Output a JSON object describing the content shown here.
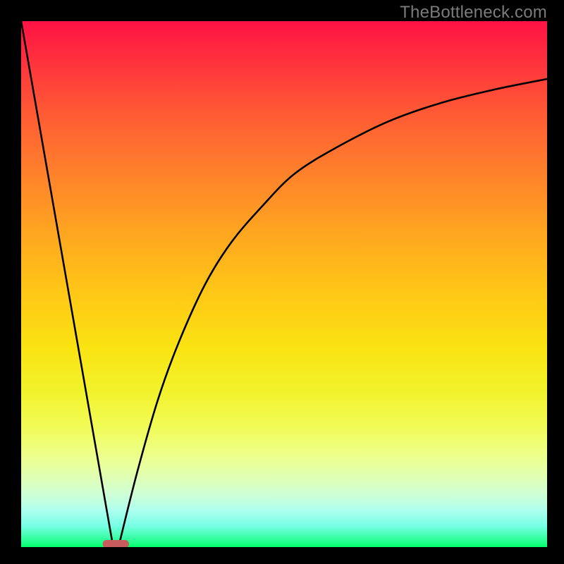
{
  "watermark": "TheBottleneck.com",
  "chart_data": {
    "type": "line",
    "title": "",
    "xlabel": "",
    "ylabel": "",
    "xlim": [
      0,
      100
    ],
    "ylim": [
      0,
      100
    ],
    "grid": false,
    "series": [
      {
        "name": "left-branch",
        "x": [
          0,
          17.5
        ],
        "values": [
          100,
          0
        ]
      },
      {
        "name": "right-branch",
        "x": [
          18.5,
          22,
          26,
          30,
          35,
          40,
          46,
          52,
          60,
          70,
          80,
          90,
          100
        ],
        "values": [
          0,
          14,
          28,
          39,
          50,
          58,
          65,
          71,
          76,
          81,
          84.5,
          87,
          89
        ]
      }
    ],
    "marker": {
      "x_center": 18.0,
      "x_halfwidth": 2.5,
      "y": 0
    }
  },
  "colors": {
    "marker": "#C75C5C",
    "curve": "#000000"
  }
}
